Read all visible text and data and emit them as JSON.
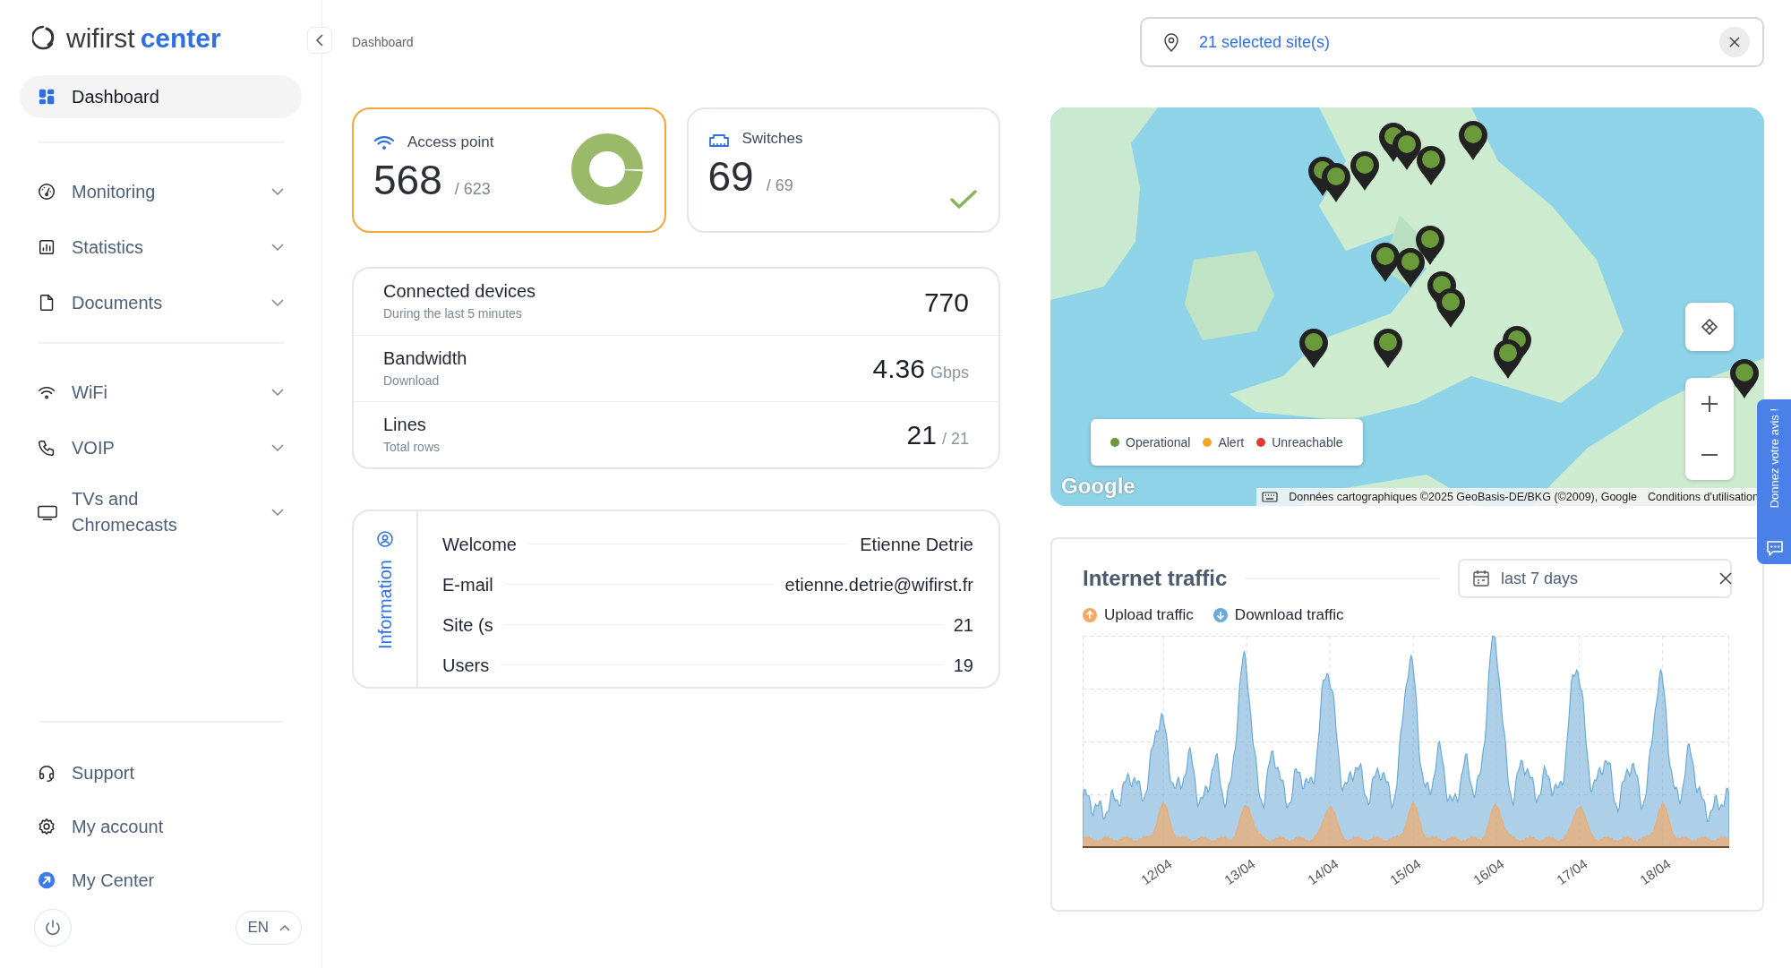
{
  "sidebar": {
    "logo": {
      "brand": "wifirst",
      "product": "center"
    },
    "groups": [
      {
        "items": [
          {
            "label": "Dashboard",
            "selected": true
          }
        ]
      },
      {
        "items": [
          {
            "label": "Monitoring",
            "selected": false,
            "expanded": false
          },
          {
            "label": "Statistics",
            "selected": false,
            "expanded": false
          },
          {
            "label": "Documents",
            "selected": false,
            "expanded": false
          }
        ]
      },
      {
        "items": [
          {
            "label": "WiFi",
            "selected": false,
            "expanded": false
          },
          {
            "label": "VOIP",
            "selected": false,
            "expanded": false
          },
          {
            "label": "TVs and Chromecasts",
            "selected": false,
            "expanded": false
          }
        ]
      },
      {
        "items": [
          {
            "label": "Support",
            "selected": false
          },
          {
            "label": "My account",
            "selected": false
          },
          {
            "label": "My Center",
            "selected": false
          }
        ]
      }
    ],
    "language": "EN"
  },
  "breadcrumb": "Dashboard",
  "site_filter": {
    "value": "21 selected site(s)"
  },
  "summary_cards": [
    {
      "kind": "access_point",
      "title": "Access point",
      "value": "568",
      "total": "/ 623",
      "alert": true,
      "level": 0.99
    },
    {
      "kind": "switches",
      "title": "Switches",
      "value": "69",
      "total": "/ 69",
      "alert": false
    }
  ],
  "stats": [
    {
      "label": "Connected devices",
      "sublabel": "During the last 5 minutes",
      "value": "770"
    },
    {
      "label": "Bandwidth",
      "sublabel": "Download",
      "value": "4.36",
      "unit": "Gbps"
    },
    {
      "label": "Lines",
      "sublabel": "Total rows",
      "value": "21",
      "unit": "/ 21"
    }
  ],
  "information": {
    "title": "Information",
    "rows": [
      {
        "label": "Welcome",
        "value": "Etienne Detrie"
      },
      {
        "label": "E-mail",
        "value": "etienne.detrie@wifirst.fr"
      },
      {
        "label": "Site (s",
        "value": "21"
      },
      {
        "label": "Users",
        "value": "19"
      }
    ]
  },
  "map": {
    "markers": [
      {
        "kind": "operational"
      },
      {
        "kind": "operational"
      },
      {
        "kind": "operational"
      },
      {
        "kind": "operational"
      },
      {
        "kind": "operational"
      },
      {
        "kind": "operational"
      },
      {
        "kind": "operational"
      },
      {
        "kind": "operational"
      },
      {
        "kind": "operational"
      },
      {
        "kind": "operational"
      },
      {
        "kind": "operational"
      },
      {
        "kind": "operational"
      },
      {
        "kind": "operational"
      },
      {
        "kind": "operational"
      },
      {
        "kind": "operational"
      },
      {
        "kind": "operational"
      },
      {
        "kind": "operational"
      }
    ],
    "legend": [
      {
        "kind": "operational",
        "label": "Operational",
        "color": "#6b9a3a"
      },
      {
        "kind": "alert",
        "label": "Alert",
        "color": "#f5a623"
      },
      {
        "kind": "unreachable",
        "label": "Unreachable",
        "color": "#e53935"
      }
    ],
    "provider_logo": "Google",
    "attribution": "Données cartographiques ©2025 GeoBasis-DE/BKG (©2009), Google",
    "terms": "Conditions d'utilisation"
  },
  "traffic": {
    "title": "Internet traffic",
    "period": {
      "value": "last 7 days"
    },
    "legend": [
      {
        "label": "Upload traffic",
        "color": "#f4a862"
      },
      {
        "label": "Download traffic",
        "color": "#6aaad6"
      }
    ],
    "x_labels": [
      "12/04",
      "13/04",
      "14/04",
      "15/04",
      "16/04",
      "17/04",
      "18/04"
    ]
  },
  "feedback": {
    "label": "Donnez votre avis !"
  }
}
